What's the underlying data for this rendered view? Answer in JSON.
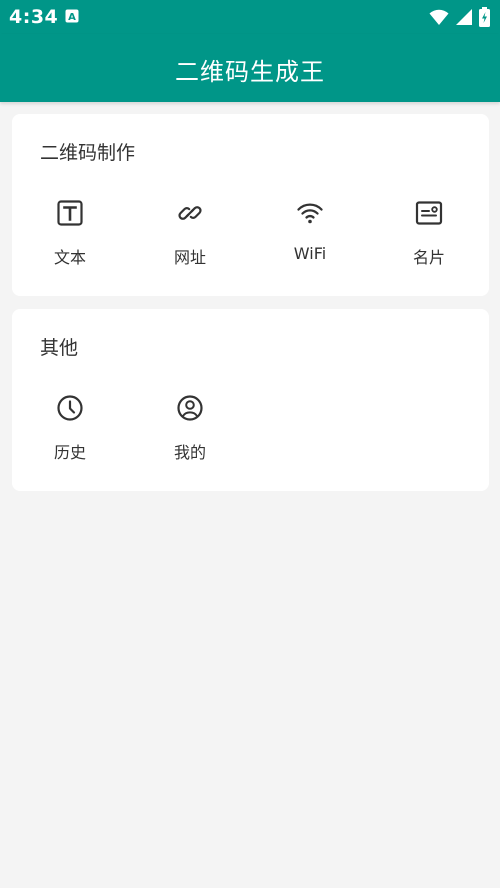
{
  "status_bar": {
    "time": "4:34",
    "notification_icon": "a-notification-icon",
    "icons": [
      "wifi-icon",
      "signal-icon",
      "battery-icon"
    ]
  },
  "app_bar": {
    "title": "二维码生成王"
  },
  "sections": {
    "make": {
      "title": "二维码制作",
      "items": [
        {
          "label": "文本",
          "icon": "text-icon"
        },
        {
          "label": "网址",
          "icon": "link-icon"
        },
        {
          "label": "WiFi",
          "icon": "wifi-icon"
        },
        {
          "label": "名片",
          "icon": "business-card-icon"
        }
      ]
    },
    "other": {
      "title": "其他",
      "items": [
        {
          "label": "历史",
          "icon": "clock-icon"
        },
        {
          "label": "我的",
          "icon": "user-icon"
        }
      ]
    }
  },
  "colors": {
    "primary": "#009688",
    "background": "#f4f4f4",
    "card": "#ffffff",
    "text": "#333333"
  }
}
